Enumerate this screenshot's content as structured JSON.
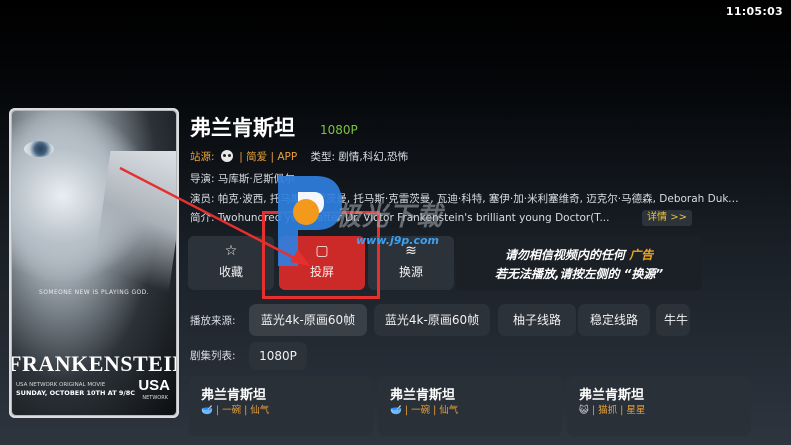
{
  "status_bar": {
    "time": "11:05:03"
  },
  "poster": {
    "tagline": "SOMEONE NEW IS PLAYING GOD.",
    "title": "FRANKENSTEIN",
    "network_line": "USA NETWORK ORIGINAL MOVIE",
    "air_date": "SUNDAY, OCTOBER 10TH AT 9/8C",
    "logo": "USA",
    "logo_sub": "NETWORK"
  },
  "movie": {
    "title": "弗兰肯斯坦",
    "quality": "1080P",
    "source_label": "站源:",
    "source_value": "| 简爱 | APP",
    "type_label": "类型: 剧情,科幻,恐怖",
    "director": "导演: 马库斯·尼斯佩尔",
    "cast": "演员: 帕克·波西, 托马斯·克雷茨曼, 托马斯·克雷茨曼, 瓦迪·科特, 塞伊·加·米利塞维奇, 迈克尔·马德森, Deborah Duke, 安·马...",
    "intro": "简介: Twohundred years after Dr. Victor Frankenstein's brilliant young Doctor(T...",
    "detail_label": "详情 >>"
  },
  "actions": {
    "favorite": {
      "icon": "☆",
      "label": "收藏"
    },
    "play": {
      "icon": "▢",
      "label": "投屏"
    },
    "switch_source": {
      "icon": "≋",
      "label": "换源"
    }
  },
  "notice": {
    "line1_a": "请勿相信视频内的任何",
    "line1_b": "广告",
    "line2_a": "若无法播放,请按左侧的",
    "line2_b": "“换源”"
  },
  "watermark": {
    "text": "极光下载",
    "url": "www.j9p.com"
  },
  "lines": {
    "label": "播放来源:",
    "items": [
      "蓝光4k-原画60帧",
      "蓝光4k-原画60帧",
      "柚子线路",
      "稳定线路",
      "牛牛"
    ],
    "selected": 0
  },
  "episodes": {
    "label": "剧集列表:",
    "items": [
      "1080P"
    ]
  },
  "cards": [
    {
      "title": "弗兰肯斯坦",
      "emoji": "🥣",
      "sub": "| 一碗 | 仙气"
    },
    {
      "title": "弗兰肯斯坦",
      "emoji": "🥣",
      "sub": "| 一碗 | 仙气"
    },
    {
      "title": "弗兰肯斯坦",
      "emoji": "😺",
      "sub": "| 猫抓 | 星星"
    }
  ],
  "colors": {
    "accent_red": "#cc2a28",
    "orange": "#e9a13b",
    "green": "#7cc43c",
    "highlight_box": "#e53030"
  }
}
